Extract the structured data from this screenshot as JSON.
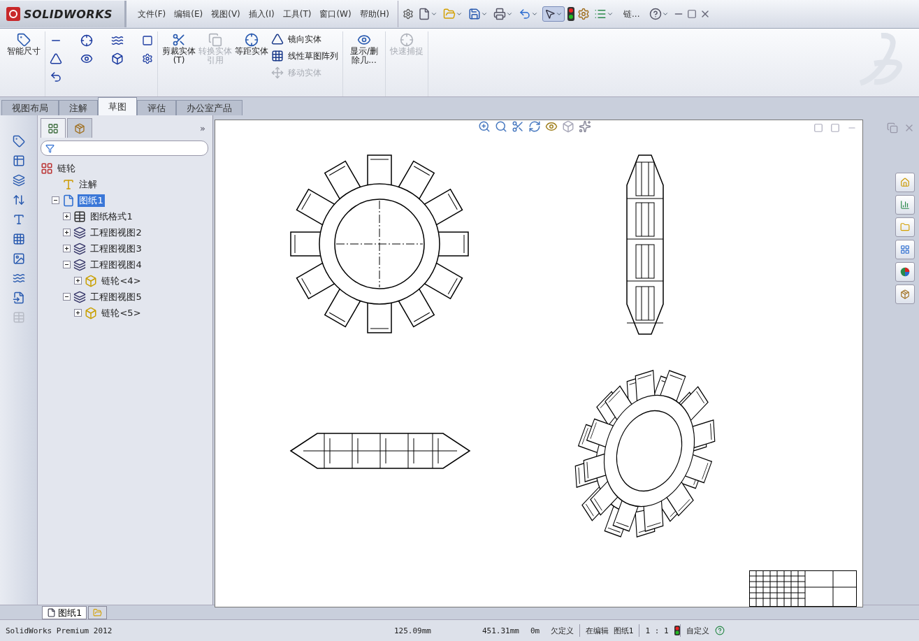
{
  "app": {
    "logo": "SOLIDWORKS"
  },
  "menu": [
    {
      "label": "文件(F)"
    },
    {
      "label": "编辑(E)"
    },
    {
      "label": "视图(V)"
    },
    {
      "label": "插入(I)"
    },
    {
      "label": "工具(T)"
    },
    {
      "label": "窗口(W)"
    },
    {
      "label": "帮助(H)"
    }
  ],
  "quick_access": {
    "document_label": "链..."
  },
  "ribbon": {
    "tools": [
      {
        "kind": "large",
        "label": "剪裁实体(T)",
        "disabled": false
      },
      {
        "kind": "large",
        "label": "转换实体引用",
        "disabled": true
      },
      {
        "kind": "large",
        "label": "等距实体",
        "disabled": false
      },
      {
        "kind": "small",
        "label": "镜向实体",
        "disabled": false
      },
      {
        "kind": "small",
        "label": "线性草图阵列",
        "disabled": false
      },
      {
        "kind": "small",
        "label": "移动实体",
        "disabled": true
      },
      {
        "kind": "large",
        "label": "显示/删除几...",
        "disabled": false
      },
      {
        "kind": "large",
        "label": "快速捕捉",
        "disabled": true
      }
    ],
    "smart_dimension": "智能尺寸"
  },
  "command_tabs": [
    {
      "label": "视图布局",
      "selected": false
    },
    {
      "label": "注解",
      "selected": false
    },
    {
      "label": "草图",
      "selected": true
    },
    {
      "label": "评估",
      "selected": false
    },
    {
      "label": "办公室产品",
      "selected": false
    }
  ],
  "feature_tree": {
    "expand_glyph": "»",
    "items": [
      {
        "label": "链轮",
        "selected": false,
        "children": [
          {
            "label": "注解",
            "selected": false
          },
          {
            "label": "图纸1",
            "selected": true,
            "expanded": true,
            "children": [
              {
                "label": "图纸格式1",
                "selected": false,
                "expanded": false
              },
              {
                "label": "工程图视图2",
                "selected": false,
                "expanded": false
              },
              {
                "label": "工程图视图3",
                "selected": false,
                "expanded": false
              },
              {
                "label": "工程图视图4",
                "selected": false,
                "expanded": true,
                "children": [
                  {
                    "label": "链轮<4>",
                    "selected": false,
                    "expanded": false
                  }
                ]
              },
              {
                "label": "工程图视图5",
                "selected": false,
                "expanded": true,
                "children": [
                  {
                    "label": "链轮<5>",
                    "selected": false,
                    "expanded": false
                  }
                ]
              }
            ]
          }
        ]
      }
    ]
  },
  "sheet_tabs": [
    {
      "label": "图纸1",
      "selected": true
    }
  ],
  "status_bar": {
    "product": "SolidWorks Premium 2012",
    "x": "125.09mm",
    "y": "451.31mm",
    "z": "0m",
    "definition": "欠定义",
    "editing": "在编辑 图纸1",
    "scale": "1 : 1",
    "units": "自定义"
  }
}
